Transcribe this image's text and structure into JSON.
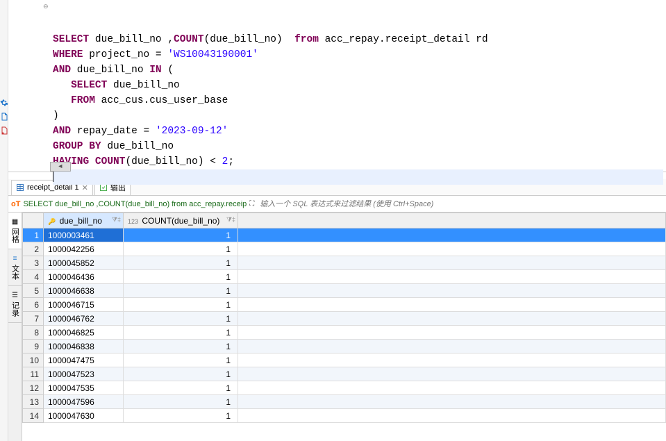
{
  "editor": {
    "lines": [
      {
        "segments": [
          {
            "t": "SELECT",
            "c": "kw"
          },
          {
            "t": " due_bill_no ,",
            "c": ""
          },
          {
            "t": "COUNT",
            "c": "kw"
          },
          {
            "t": "(due_bill_no)  ",
            "c": ""
          },
          {
            "t": "from",
            "c": "kw"
          },
          {
            "t": " acc_repay.receipt_detail rd",
            "c": ""
          }
        ]
      },
      {
        "segments": [
          {
            "t": "WHERE",
            "c": "kw"
          },
          {
            "t": " project_no = ",
            "c": ""
          },
          {
            "t": "'WS10043190001'",
            "c": "str"
          }
        ]
      },
      {
        "segments": [
          {
            "t": "AND",
            "c": "kw"
          },
          {
            "t": " due_bill_no ",
            "c": ""
          },
          {
            "t": "IN",
            "c": "kw"
          },
          {
            "t": " (",
            "c": ""
          }
        ]
      },
      {
        "indent": "   ",
        "segments": [
          {
            "t": "SELECT",
            "c": "kw"
          },
          {
            "t": " due_bill_no",
            "c": ""
          }
        ]
      },
      {
        "indent": "   ",
        "segments": [
          {
            "t": "FROM",
            "c": "kw"
          },
          {
            "t": " acc_cus.cus_user_base",
            "c": ""
          }
        ]
      },
      {
        "segments": [
          {
            "t": ")",
            "c": ""
          }
        ]
      },
      {
        "segments": [
          {
            "t": "AND",
            "c": "kw"
          },
          {
            "t": " repay_date = ",
            "c": ""
          },
          {
            "t": "'2023-09-12'",
            "c": "str"
          }
        ]
      },
      {
        "segments": [
          {
            "t": "GROUP",
            "c": "kw"
          },
          {
            "t": " ",
            "c": ""
          },
          {
            "t": "BY",
            "c": "kw"
          },
          {
            "t": " due_bill_no",
            "c": ""
          }
        ]
      },
      {
        "segments": [
          {
            "t": "HAVING",
            "c": "kw"
          },
          {
            "t": " ",
            "c": ""
          },
          {
            "t": "COUNT",
            "c": "kw"
          },
          {
            "t": "(due_bill_no) < ",
            "c": ""
          },
          {
            "t": "2",
            "c": "str"
          },
          {
            "t": ";",
            "c": ""
          }
        ]
      },
      {
        "cursor": true,
        "segments": []
      }
    ]
  },
  "tabs": {
    "result_tab": "receipt_detail 1",
    "output_tab": "输出"
  },
  "filter_bar": {
    "exec_label": "oT",
    "sql_preview": "SELECT due_bill_no ,COUNT(due_bill_no) from acc_repay.receip",
    "filter_placeholder": "输入一个 SQL 表达式来过滤结果 (使用 Ctrl+Space)"
  },
  "side_tabs": {
    "grid": "网格",
    "text": "文本",
    "record": "记录"
  },
  "columns": {
    "col1": "due_bill_no",
    "col2": "COUNT(due_bill_no)"
  },
  "rows": [
    {
      "n": "1",
      "due": "1000003461",
      "cnt": "1",
      "sel": true
    },
    {
      "n": "2",
      "due": "1000042256",
      "cnt": "1"
    },
    {
      "n": "3",
      "due": "1000045852",
      "cnt": "1"
    },
    {
      "n": "4",
      "due": "1000046436",
      "cnt": "1"
    },
    {
      "n": "5",
      "due": "1000046638",
      "cnt": "1"
    },
    {
      "n": "6",
      "due": "1000046715",
      "cnt": "1"
    },
    {
      "n": "7",
      "due": "1000046762",
      "cnt": "1"
    },
    {
      "n": "8",
      "due": "1000046825",
      "cnt": "1"
    },
    {
      "n": "9",
      "due": "1000046838",
      "cnt": "1"
    },
    {
      "n": "10",
      "due": "1000047475",
      "cnt": "1"
    },
    {
      "n": "11",
      "due": "1000047523",
      "cnt": "1"
    },
    {
      "n": "12",
      "due": "1000047535",
      "cnt": "1"
    },
    {
      "n": "13",
      "due": "1000047596",
      "cnt": "1"
    },
    {
      "n": "14",
      "due": "1000047630",
      "cnt": "1"
    }
  ]
}
